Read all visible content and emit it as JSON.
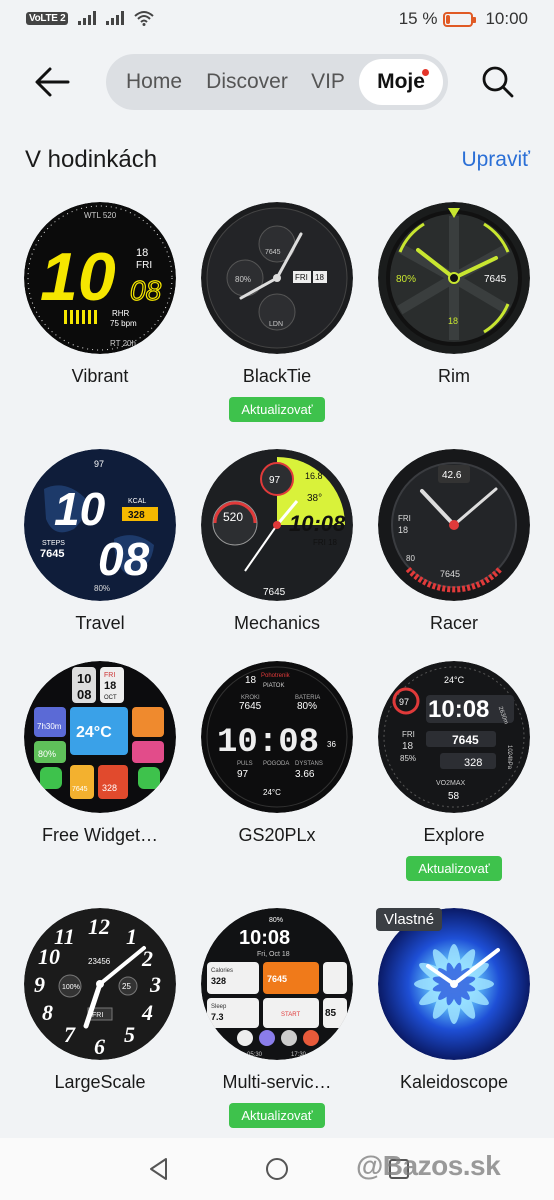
{
  "status_bar": {
    "volte": "VoLTE 2",
    "battery_percent_text": "15 %",
    "battery_level": 0.15,
    "time": "10:00"
  },
  "nav": {
    "back_icon": "arrow-left-icon",
    "search_icon": "search-icon",
    "tabs": [
      {
        "label": "Home",
        "active": false
      },
      {
        "label": "Discover",
        "active": false
      },
      {
        "label": "VIP",
        "active": false
      },
      {
        "label": "Moje",
        "active": true,
        "badge": true
      }
    ]
  },
  "section": {
    "title": "V hodinkách",
    "edit_label": "Upraviť"
  },
  "faces": [
    {
      "name": "Vibrant",
      "update": null,
      "texts": {
        "big": "10",
        "small": "08",
        "day": "18",
        "wd": "FRI",
        "top": "WTL 520",
        "rhr": "RHR",
        "bpm": "75 bpm",
        "rt": "RT 20h"
      }
    },
    {
      "name": "BlackTie",
      "update": "Aktualizovať",
      "texts": {
        "a": "7645",
        "date1": "FRI",
        "date2": "18",
        "pct": "80%",
        "ldn": "LDN"
      }
    },
    {
      "name": "Rim",
      "update": null,
      "texts": {
        "pct": "80%",
        "steps": "7645",
        "day": "18"
      }
    },
    {
      "name": "Travel",
      "update": null,
      "texts": {
        "hr": "97",
        "h": "10",
        "m": "08",
        "kcal": "KCAL",
        "kv": "328",
        "steps": "STEPS",
        "sv": "7645",
        "bat": "80%"
      }
    },
    {
      "name": "Mechanics",
      "update": null,
      "texts": {
        "hr": "97",
        "km": "16.8",
        "temp": "38°",
        "time": "10:08",
        "fri": "FRI 18",
        "wtl": "520",
        "steps": "7645"
      }
    },
    {
      "name": "Racer",
      "update": null,
      "texts": {
        "v": "42.6",
        "fri": "FRI",
        "d": "18",
        "steps": "7645",
        "pct": "80"
      }
    },
    {
      "name": "Free Widget…",
      "update": null,
      "texts": {
        "h": "10",
        "m": "08",
        "fri": "FRI",
        "d": "18",
        "oct": "OCT",
        "sleep": "7h30m",
        "temp": "24°C",
        "bat": "80%",
        "kcal": "328",
        "steps": "7645"
      }
    },
    {
      "name": "GS20PLx",
      "update": null,
      "texts": {
        "d": "18",
        "brand": "Pohotrenik",
        "wd": "PIATOK",
        "kroki": "KROKI",
        "kv": "7645",
        "bat": "BATERIA",
        "bv": "80%",
        "time": "10:08",
        "sec": "36",
        "puls": "PULS",
        "pv": "97",
        "pog": "POGODA",
        "t": "24°C",
        "dys": "DYSTANS",
        "dv": "3.66"
      }
    },
    {
      "name": "Explore",
      "update": "Aktualizovať",
      "texts": {
        "temp": "24°C",
        "hr": "97",
        "time": "10:08",
        "fri": "FRI",
        "d": "18",
        "steps": "7645",
        "pct": "85%",
        "kcal": "328",
        "vo": "VO2MAX",
        "vv": "58",
        "alt": "2630m",
        "pr": "1024hPa"
      }
    },
    {
      "name": "LargeScale",
      "update": null,
      "texts": {
        "steps": "23456",
        "pct": "100%",
        "d": "25",
        "fri": "FRI"
      }
    },
    {
      "name": "Multi-servic…",
      "update": "Aktualizovať",
      "texts": {
        "bat": "80%",
        "time": "10:08",
        "date": "Fri, Oct 18",
        "cal": "Calories",
        "cv": "328",
        "steps": "7645",
        "sleep": "Sleep",
        "sv": "7.3",
        "start": "START",
        "hr": "85",
        "sun1": "05:30",
        "sun2": "17:30"
      }
    },
    {
      "name": "Kaleidoscope",
      "update": null,
      "custom_tag": "Vlastné",
      "texts": {}
    }
  ],
  "bottom_nav": {
    "back_icon": "triangle-back-icon",
    "home_icon": "circle-home-icon",
    "recent_icon": "square-recent-icon"
  },
  "watermark": "@Bazos.sk",
  "colors": {
    "accent_link": "#2b6fd6",
    "update_badge": "#3ec24c",
    "battery_low": "#e05a25",
    "tab_badge": "#e4352a"
  }
}
